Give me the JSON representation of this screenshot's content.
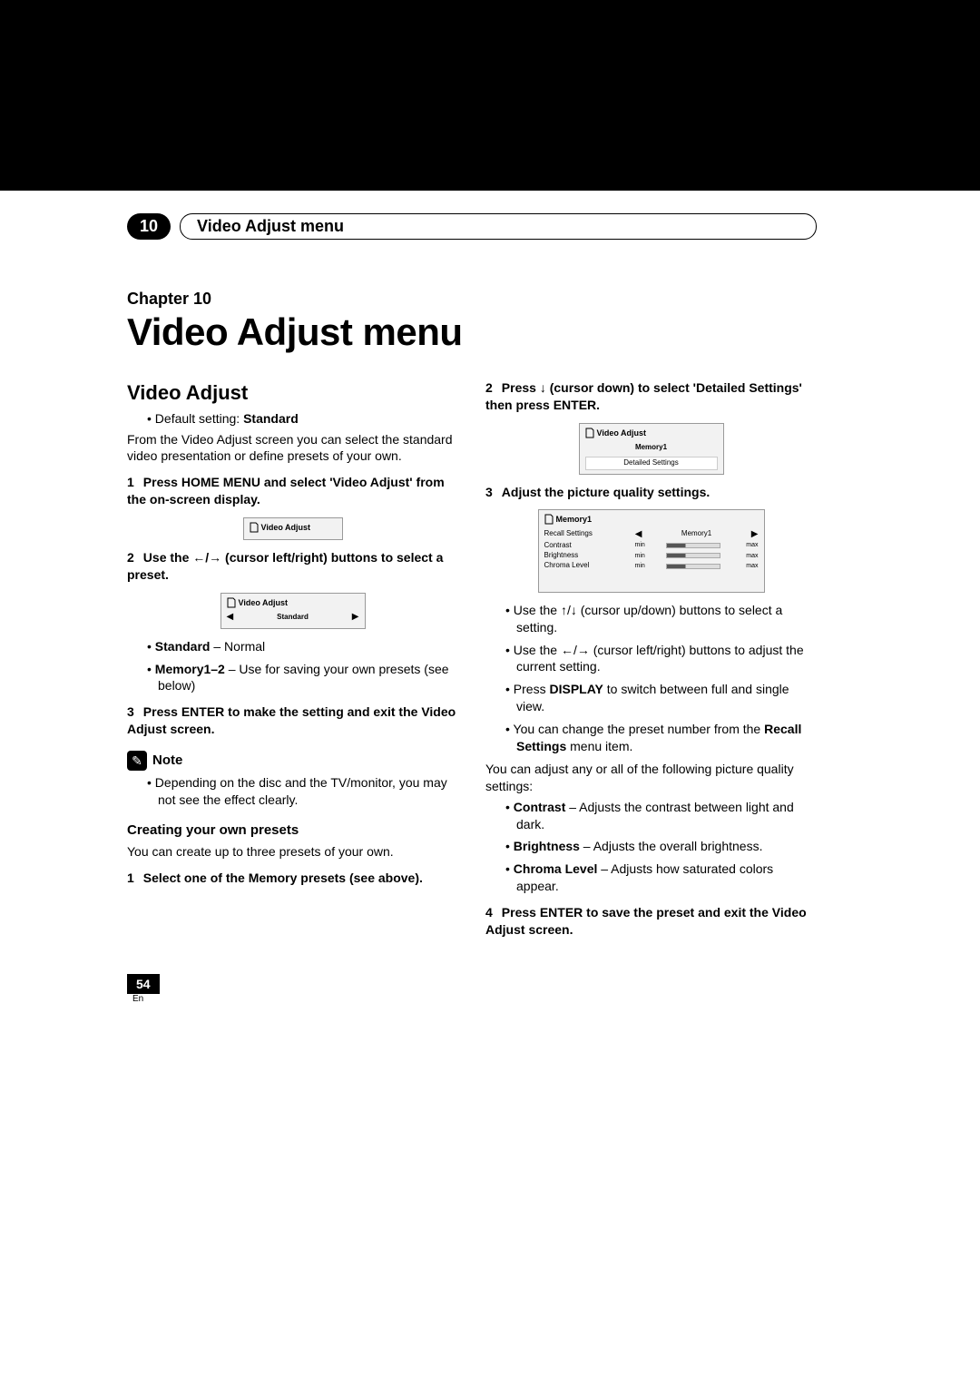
{
  "header": {
    "chapter_badge": "10",
    "chapter_title": "Video Adjust menu"
  },
  "titleblock": {
    "chapter_label": "Chapter 10",
    "main_title": "Video Adjust menu"
  },
  "left": {
    "h2": "Video Adjust",
    "default_label": "Default setting:",
    "default_value": "Standard",
    "intro": "From the Video Adjust screen you can select the standard video presentation or define presets of your own.",
    "step1": "Press HOME MENU and select 'Video Adjust' from the on-screen display.",
    "osd1_title": "Video Adjust",
    "step2_before": "Use the ",
    "step2_after": " (cursor left/right) buttons to select a preset.",
    "osd2_title": "Video Adjust",
    "osd2_value": "Standard",
    "preset_std_label": "Standard",
    "preset_std_desc": " – Normal",
    "preset_mem_label": "Memory1–2",
    "preset_mem_desc": " – Use for saving your own presets (see below)",
    "step3": "Press ENTER to make the setting and exit the Video Adjust screen.",
    "note_label": "Note",
    "note_text": "Depending on the disc and the TV/monitor, you may not see the effect clearly.",
    "h3": "Creating your own presets",
    "h3_intro": "You can create up to three presets of your own.",
    "cp_step1": "Select one of the Memory presets (see above)."
  },
  "right": {
    "cp_step2_before": "Press ",
    "cp_step2_after": " (cursor down) to select 'Detailed Settings' then press ENTER.",
    "osd3_title": "Video Adjust",
    "osd3_row1": "Memory1",
    "osd3_row2": "Detailed Settings",
    "cp_step3": "Adjust the picture quality settings.",
    "osd4_title": "Memory1",
    "osd4_rows": {
      "recall": "Recall Settings",
      "recall_val": "Memory1",
      "contrast": "Contrast",
      "brightness": "Brightness",
      "chroma": "Chroma Level",
      "min": "min",
      "max": "max"
    },
    "tips_updown_before": "Use the ",
    "tips_updown_after": " (cursor up/down) buttons to select a setting.",
    "tips_lr_before": "Use the ",
    "tips_lr_after": " (cursor left/right) buttons to adjust the current setting.",
    "tips_display_before": "Press ",
    "tips_display_bold": "DISPLAY",
    "tips_display_after": " to switch between full and single view.",
    "tips_recall_before": "You can change the preset number from the ",
    "tips_recall_bold": "Recall Settings",
    "tips_recall_after": " menu item.",
    "pq_intro": "You can adjust any or all of the following picture quality settings:",
    "pq_contrast_label": "Contrast",
    "pq_contrast_desc": " – Adjusts the contrast between light and dark.",
    "pq_bright_label": "Brightness",
    "pq_bright_desc": " – Adjusts the overall brightness.",
    "pq_chroma_label": "Chroma Level",
    "pq_chroma_desc": " – Adjusts how saturated colors appear.",
    "cp_step4": "Press ENTER to save the preset and exit the Video Adjust screen."
  },
  "footer": {
    "page": "54",
    "lang": "En"
  }
}
